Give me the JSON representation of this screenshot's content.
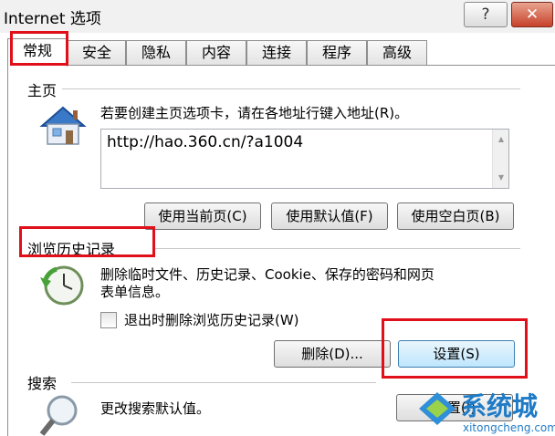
{
  "window": {
    "title": "Internet 选项",
    "help_label": "?",
    "close_label": "✕"
  },
  "tabs": [
    {
      "label": "常规",
      "active": true
    },
    {
      "label": "安全"
    },
    {
      "label": "隐私"
    },
    {
      "label": "内容"
    },
    {
      "label": "连接"
    },
    {
      "label": "程序"
    },
    {
      "label": "高级"
    }
  ],
  "homepage": {
    "title": "主页",
    "description": "若要创建主页选项卡，请在各地址行键入地址(R)。",
    "url": "http://hao.360.cn/?a1004",
    "buttons": {
      "use_current": "使用当前页(C)",
      "use_default": "使用默认值(F)",
      "use_blank": "使用空白页(B)"
    }
  },
  "history": {
    "title": "浏览历史记录",
    "description_line1": "删除临时文件、历史记录、Cookie、保存的密码和网页",
    "description_line2": "表单信息。",
    "checkbox_label": "退出时删除浏览历史记录(W)",
    "checkbox_checked": false,
    "delete_label": "删除(D)...",
    "settings_label": "设置(S)"
  },
  "search": {
    "title": "搜索",
    "description": "更改搜索默认值。",
    "settings_label": "设置(I)"
  },
  "watermark": {
    "brand": "系统城",
    "url": "xitongcheng.com"
  },
  "colors": {
    "highlight": "#e0101a",
    "accent": "#1f7bc6"
  }
}
